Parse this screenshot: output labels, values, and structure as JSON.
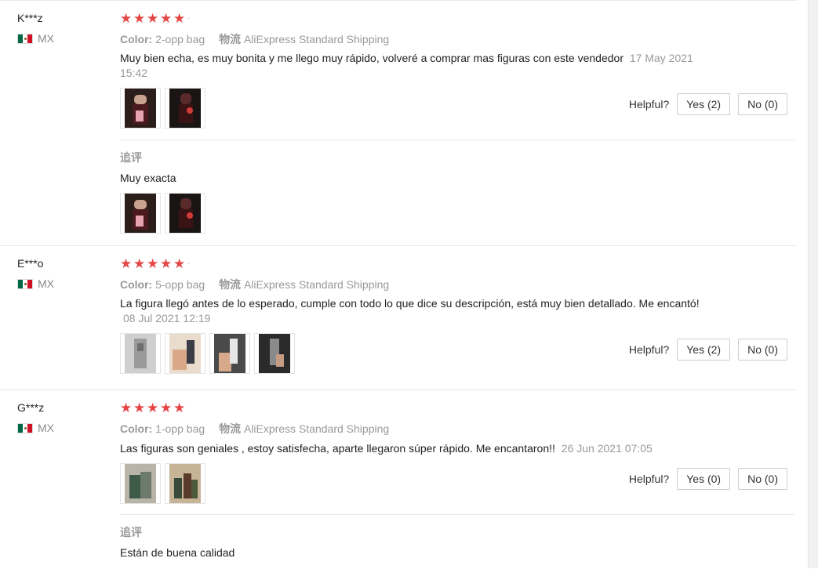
{
  "reviews": [
    {
      "user": "K***z",
      "country": "MX",
      "color_label": "Color:",
      "color_value": "2-opp bag",
      "shipping_label": "物流",
      "shipping_value": "AliExpress Standard Shipping",
      "rating": 5,
      "text": "Muy bien echa, es muy bonita y me llego muy rápido, volveré a comprar mas figuras con este vendedor",
      "date": "17 May 2021",
      "time": "15:42",
      "helpful_label": "Helpful?",
      "yes_label": "Yes (2)",
      "no_label": "No (0)",
      "followup_label": "追评",
      "followup_text": "Muy exacta"
    },
    {
      "user": "E***o",
      "country": "MX",
      "color_label": "Color:",
      "color_value": "5-opp bag",
      "shipping_label": "物流",
      "shipping_value": "AliExpress Standard Shipping",
      "rating": 5,
      "text": "La figura llegó antes de lo esperado, cumple con todo lo que dice su descripción, está muy bien detallado. Me encantó!",
      "date": "08 Jul 2021 12:19",
      "helpful_label": "Helpful?",
      "yes_label": "Yes (2)",
      "no_label": "No (0)"
    },
    {
      "user": "G***z",
      "country": "MX",
      "color_label": "Color:",
      "color_value": "1-opp bag",
      "shipping_label": "物流",
      "shipping_value": "AliExpress Standard Shipping",
      "rating": 5,
      "text": "Las figuras son geniales , estoy satisfecha, aparte llegaron súper rápido. Me encantaron!!",
      "date": "26 Jun 2021 07:05",
      "helpful_label": "Helpful?",
      "yes_label": "Yes (0)",
      "no_label": "No (0)",
      "followup_label": "追评",
      "followup_text": "Están de buena calidad"
    }
  ],
  "colors": {
    "star": "#e64545",
    "muted": "#999999",
    "border": "#e8e8e8"
  }
}
